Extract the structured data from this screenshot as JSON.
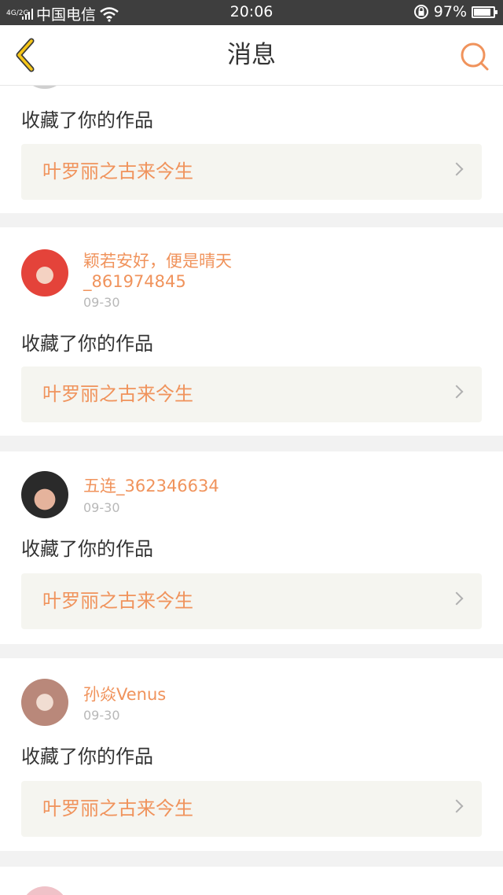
{
  "status": {
    "network": "4G/2G",
    "carrier": "中国电信",
    "time": "20:06",
    "battery": "97%",
    "battery_level": 0.97
  },
  "header": {
    "title": "消息"
  },
  "colors": {
    "accent": "#f0935c",
    "back_icon": "#f5c518"
  },
  "messages": [
    {
      "action": "收藏了你的作品",
      "work_title": "叶罗丽之古来今生"
    },
    {
      "user": "颖若安好，便是晴天_861974845",
      "date": "09-30",
      "action": "收藏了你的作品",
      "work_title": "叶罗丽之古来今生"
    },
    {
      "user": "五连_362346634",
      "date": "09-30",
      "action": "收藏了你的作品",
      "work_title": "叶罗丽之古来今生"
    },
    {
      "user": "孙焱Venus",
      "date": "09-30",
      "action": "收藏了你的作品",
      "work_title": "叶罗丽之古来今生"
    }
  ]
}
